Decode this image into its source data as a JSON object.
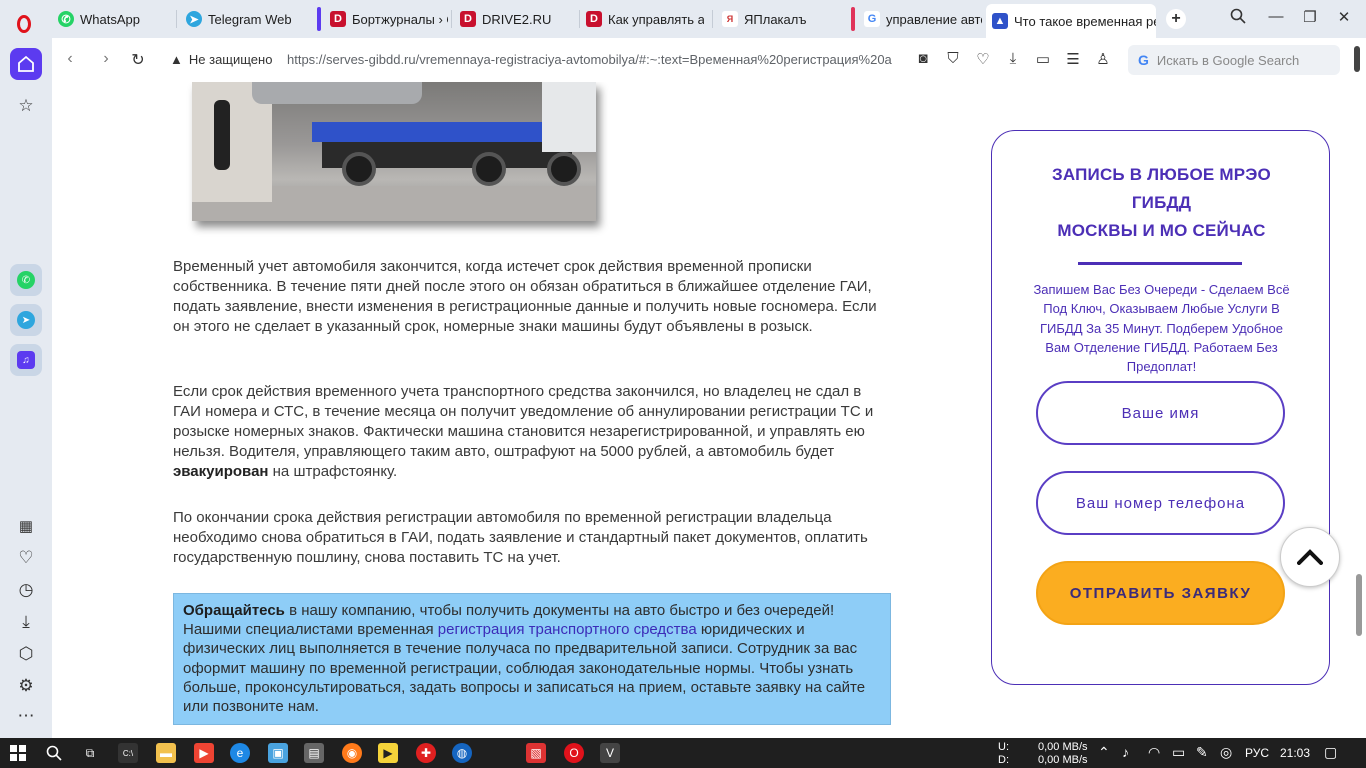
{
  "browser": {
    "tabs": [
      {
        "label": "WhatsApp",
        "icon": "whatsapp-icon",
        "color": "#25d366"
      },
      {
        "label": "Telegram Web",
        "icon": "telegram-icon",
        "color": "#2ea6de"
      },
      {
        "label": "Бортжурналы › Оп",
        "icon": "drive2-icon",
        "color": "#c8102e"
      },
      {
        "label": "DRIVE2.RU",
        "icon": "drive2-icon",
        "color": "#c8102e"
      },
      {
        "label": "Как управлять авт",
        "icon": "drive2-icon",
        "color": "#c8102e"
      },
      {
        "label": "ЯПлакалъ",
        "icon": "yaplakal-icon",
        "color": "#cc3333"
      },
      {
        "label": "управление авто",
        "icon": "google-icon",
        "color": "#4285f4"
      },
      {
        "label": "Что такое временная рег",
        "icon": "site-favicon-icon",
        "color": "#2f52c9"
      }
    ],
    "address": {
      "warning": "Не защищено",
      "url": "https://serves-gibdd.ru/vremennaya-registraciya-avtomobilya/#:~:text=Временная%20регистрация%20a"
    },
    "search_placeholder": "Искать в Google Search"
  },
  "article": {
    "p1": "Временный учет автомобиля закончится, когда истечет срок действия временной прописки собственника. В течение пяти дней после этого он обязан обратиться в ближайшее отделение ГАИ, подать заявление, внести изменения в регистрационные данные и получить новые госномера. Если он этого не сделает в указанный срок, номерные знаки машины будут объявлены в розыск.",
    "p2_before": "Если срок действия временного учета транспортного средства закончился, но владелец не сдал в ГАИ номера и СТС, в течение месяца он получит уведомление об аннулировании регистрации ТС и розыске номерных знаков. Фактически машина становится незарегистрированной, и управлять ею нельзя. Водителя, управляющего таким авто, оштрафуют на 5000 рублей, а автомобиль будет ",
    "p2_bold": "эвакуирован",
    "p2_after": " на штрафстоянку.",
    "p3": "По окончании срока действия регистрации автомобиля по временной регистрации владельца необходимо снова обратиться в ГАИ, подать заявление и стандартный пакет документов, оплатить государственную пошлину, снова поставить ТС на учет.",
    "callout_bold": "Обращайтесь",
    "callout_a": " в нашу компанию, чтобы получить документы на авто быстро и без очередей! Нашими специалистами временная ",
    "callout_link": "регистрация транспортного средства",
    "callout_b": " юридических и физических лиц выполняется в течение получаса по предварительной записи. Сотрудник за вас оформит машину по временной регистрации, соблюдая законодательные нормы. Чтобы узнать больше, проконсультироваться, задать вопросы и записаться на прием, оставьте заявку на сайте или позвоните нам."
  },
  "form": {
    "title_line1": "ЗАПИСЬ В ЛЮБОЕ МРЭО",
    "title_line2": "ГИБДД",
    "title_line3": "МОСКВЫ И МО СЕЙЧАС",
    "description": "Запишем Вас Без Очереди - Сделаем Всё Под Ключ, Оказываем Любые Услуги В ГИБДД За 35 Минут. Подберем Удобное Вам Отделение ГИБДД. Работаем Без Предоплат!",
    "name_placeholder": "Ваше имя",
    "phone_placeholder": "Ваш номер телефона",
    "submit_label": "ОТПРАВИТЬ ЗАЯВКУ",
    "accent_color": "#4c2fb6",
    "button_color": "#fbad20"
  },
  "taskbar": {
    "net_up_label": "U:",
    "net_down_label": "D:",
    "net_up": "0,00 MB/s",
    "net_down": "0,00 MB/s",
    "lang": "РУС",
    "time": "21:03"
  }
}
